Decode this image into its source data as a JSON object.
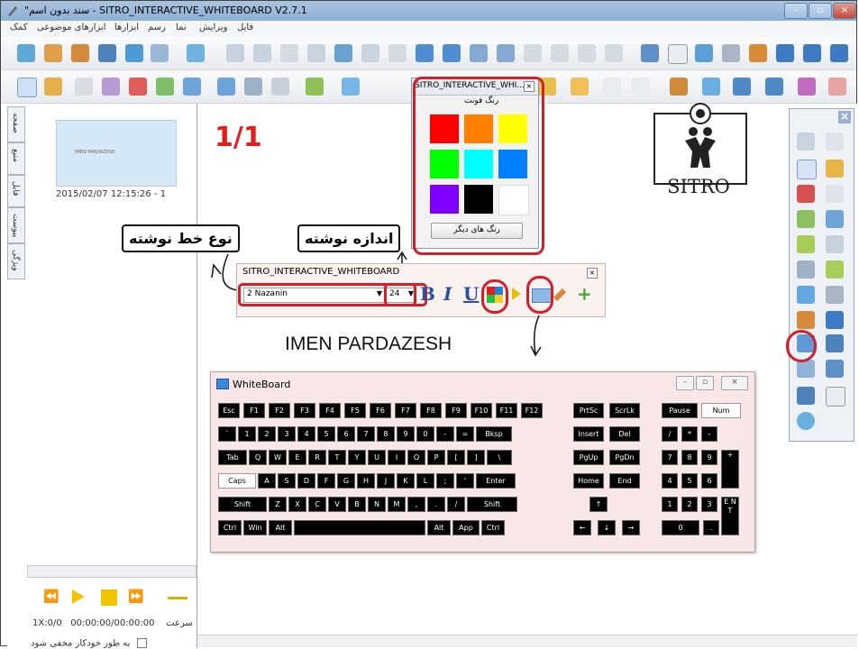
{
  "window": {
    "title": "\"سند بدون اسم - SITRO_INTERACTIVE_WHITEBOARD V2.7.1",
    "controls": [
      "–",
      "▫",
      "×"
    ]
  },
  "menu": [
    "کمک",
    "ابزارهای موضوعی",
    "ابزارها",
    "رسم",
    "نما",
    "ویرایش",
    "فایل"
  ],
  "left_tabs": [
    "صفحه",
    "منبع",
    "فایل",
    "پیوست",
    "ویژگی"
  ],
  "thumbnail": {
    "caption": "2015/02/07 12:15:26 - 1",
    "preview_text": "IMEN PARDAZESH"
  },
  "player": {
    "speed": "1X:سرعت",
    "time": "00:00:00/00:00:00",
    "frames": "0/0",
    "auto_hide": "به طور خودکار مخفی شود"
  },
  "canvas": {
    "page_indicator": "1/1",
    "logo_text": "SITRO",
    "heading": "IMEN PARDAZESH",
    "callout_font_type": "نوع خط نوشته",
    "callout_font_size": "اندازه نوشته"
  },
  "color_popup": {
    "title": "SITRO_INTERACTIVE_WHI...",
    "label": "رنگ فونت",
    "more_button": "رنگ های دیگر",
    "swatches": [
      "#ff0000",
      "#ff8000",
      "#ffff00",
      "#00ff00",
      "#00ffff",
      "#0080ff",
      "#8000ff",
      "#000000",
      "#ffffff"
    ]
  },
  "font_toolbar": {
    "title": "SITRO_INTERACTIVE_WHITEBOARD",
    "font_name": "2 Nazanin",
    "font_size": "24",
    "bold": "B",
    "italic": "I",
    "underline": "U",
    "add": "+"
  },
  "keyboard": {
    "title": "WhiteBoard",
    "rows_main": [
      [
        "Esc",
        "F1",
        "F2",
        "F3",
        "F4",
        "F5",
        "F6",
        "F7",
        "F8",
        "F9",
        "F10",
        "F11",
        "F12"
      ],
      [
        "`",
        "1",
        "2",
        "3",
        "4",
        "5",
        "6",
        "7",
        "8",
        "9",
        "0",
        "-",
        "=",
        "Bksp"
      ],
      [
        "Tab",
        "Q",
        "W",
        "E",
        "R",
        "T",
        "Y",
        "U",
        "I",
        "O",
        "P",
        "[",
        "]",
        "\\"
      ],
      [
        "Caps",
        "A",
        "S",
        "D",
        "F",
        "G",
        "H",
        "J",
        "K",
        "L",
        ";",
        "'",
        "Enter"
      ],
      [
        "Shift",
        "Z",
        "X",
        "C",
        "V",
        "B",
        "N",
        "M",
        ",",
        ".",
        "/",
        "Shift"
      ],
      [
        "Ctrl",
        "Win",
        "Alt",
        "",
        "Alt",
        "App",
        "Ctrl"
      ]
    ],
    "rows_nav": [
      [
        "PrtSc",
        "ScrLk"
      ],
      [
        "Insert",
        "Del"
      ],
      [
        "PgUp",
        "PgDn"
      ],
      [
        "Home",
        "End"
      ],
      [
        "↑"
      ],
      [
        "←",
        "↓",
        "→"
      ]
    ],
    "rows_num": [
      [
        "Pause",
        "Num"
      ],
      [
        "/",
        "*",
        "-"
      ],
      [
        "7",
        "8",
        "9",
        "+"
      ],
      [
        "4",
        "5",
        "6"
      ],
      [
        "1",
        "2",
        "3",
        "ENT"
      ],
      [
        "0",
        "."
      ]
    ]
  }
}
